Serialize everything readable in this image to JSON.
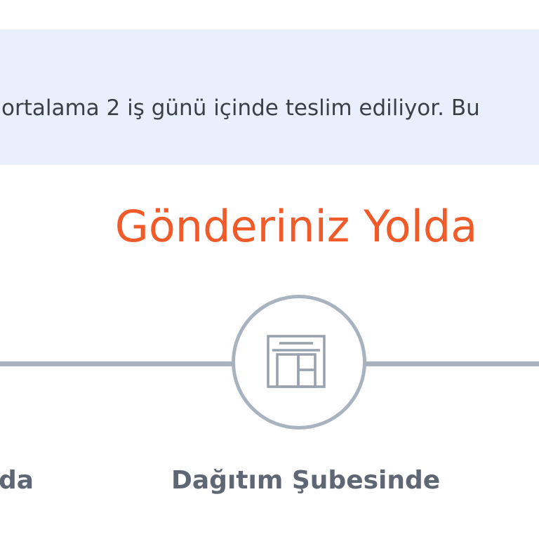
{
  "banner": {
    "text": "ortalama 2 iş günü içinde teslim ediliyor. Bu"
  },
  "status": {
    "title": "Gönderiniz Yolda",
    "accent_color": "#f15a29"
  },
  "tracker": {
    "line_color": "#a9b2bf",
    "steps": [
      {
        "label": "da",
        "state": "completed"
      },
      {
        "label": "Dağıtım Şubesinde",
        "icon": "branch-building-icon",
        "state": "current"
      }
    ]
  }
}
